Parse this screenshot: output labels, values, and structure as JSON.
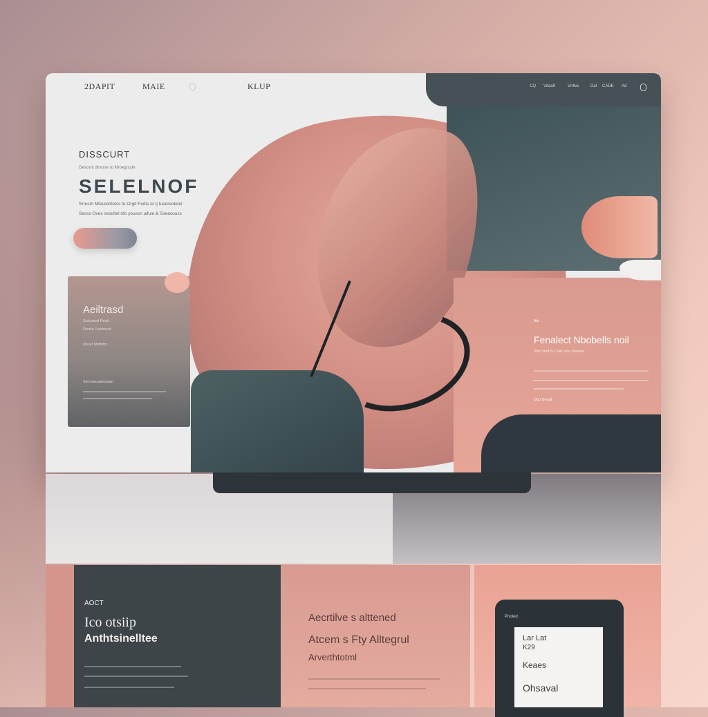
{
  "nav": {
    "logo": "2DAPIT",
    "link1": "MAIE",
    "link2": "KLUP",
    "small_note": "",
    "right_links": [
      "CQ",
      "Vitaalt",
      "Vntlvs",
      "Dal",
      "CADE",
      "Ad"
    ]
  },
  "hero": {
    "eyebrow": "DISSCURT",
    "kicker": "Descvnt dtocrse ro Mroegrccfe",
    "headline": "SELELNOF",
    "lead1": "Srresm Mteuretrtelss fe Orgit Fedis-te Ij tueereoletel",
    "lead2": "Sesss Oves sesoltel nfo youssn uifuie & Sseacuuss"
  },
  "side_card": {
    "title": "Aeiltrasd",
    "meta1": "Satcaaed Resd",
    "meta2": "Deniie Ueatrrscd",
    "meta3": "Ntvsd Mntlntnr",
    "meta4": "Ssevseoaarnssan"
  },
  "feature": {
    "tag": "Nts",
    "title": "Fenalect Nbobells noil",
    "subtitle": "Sfot Slod fs Colic Vds Srsoeol",
    "more": "Oco Dnctd"
  },
  "bottom": {
    "kicker": "AOCT",
    "title1": "Ico otsiip",
    "title2": "Anthtsinelltee",
    "mid_title": "Aecrtilve s alttened",
    "mid_sub1": "Atcem s Fty Alltegrul",
    "mid_sub2": "Arverthtotml",
    "phone_brand": "Pnoled",
    "phone_p1": "Lar Lat",
    "phone_p2": "K29",
    "phone_p3": "Keaes",
    "phone_p4": "Ohsaval"
  }
}
